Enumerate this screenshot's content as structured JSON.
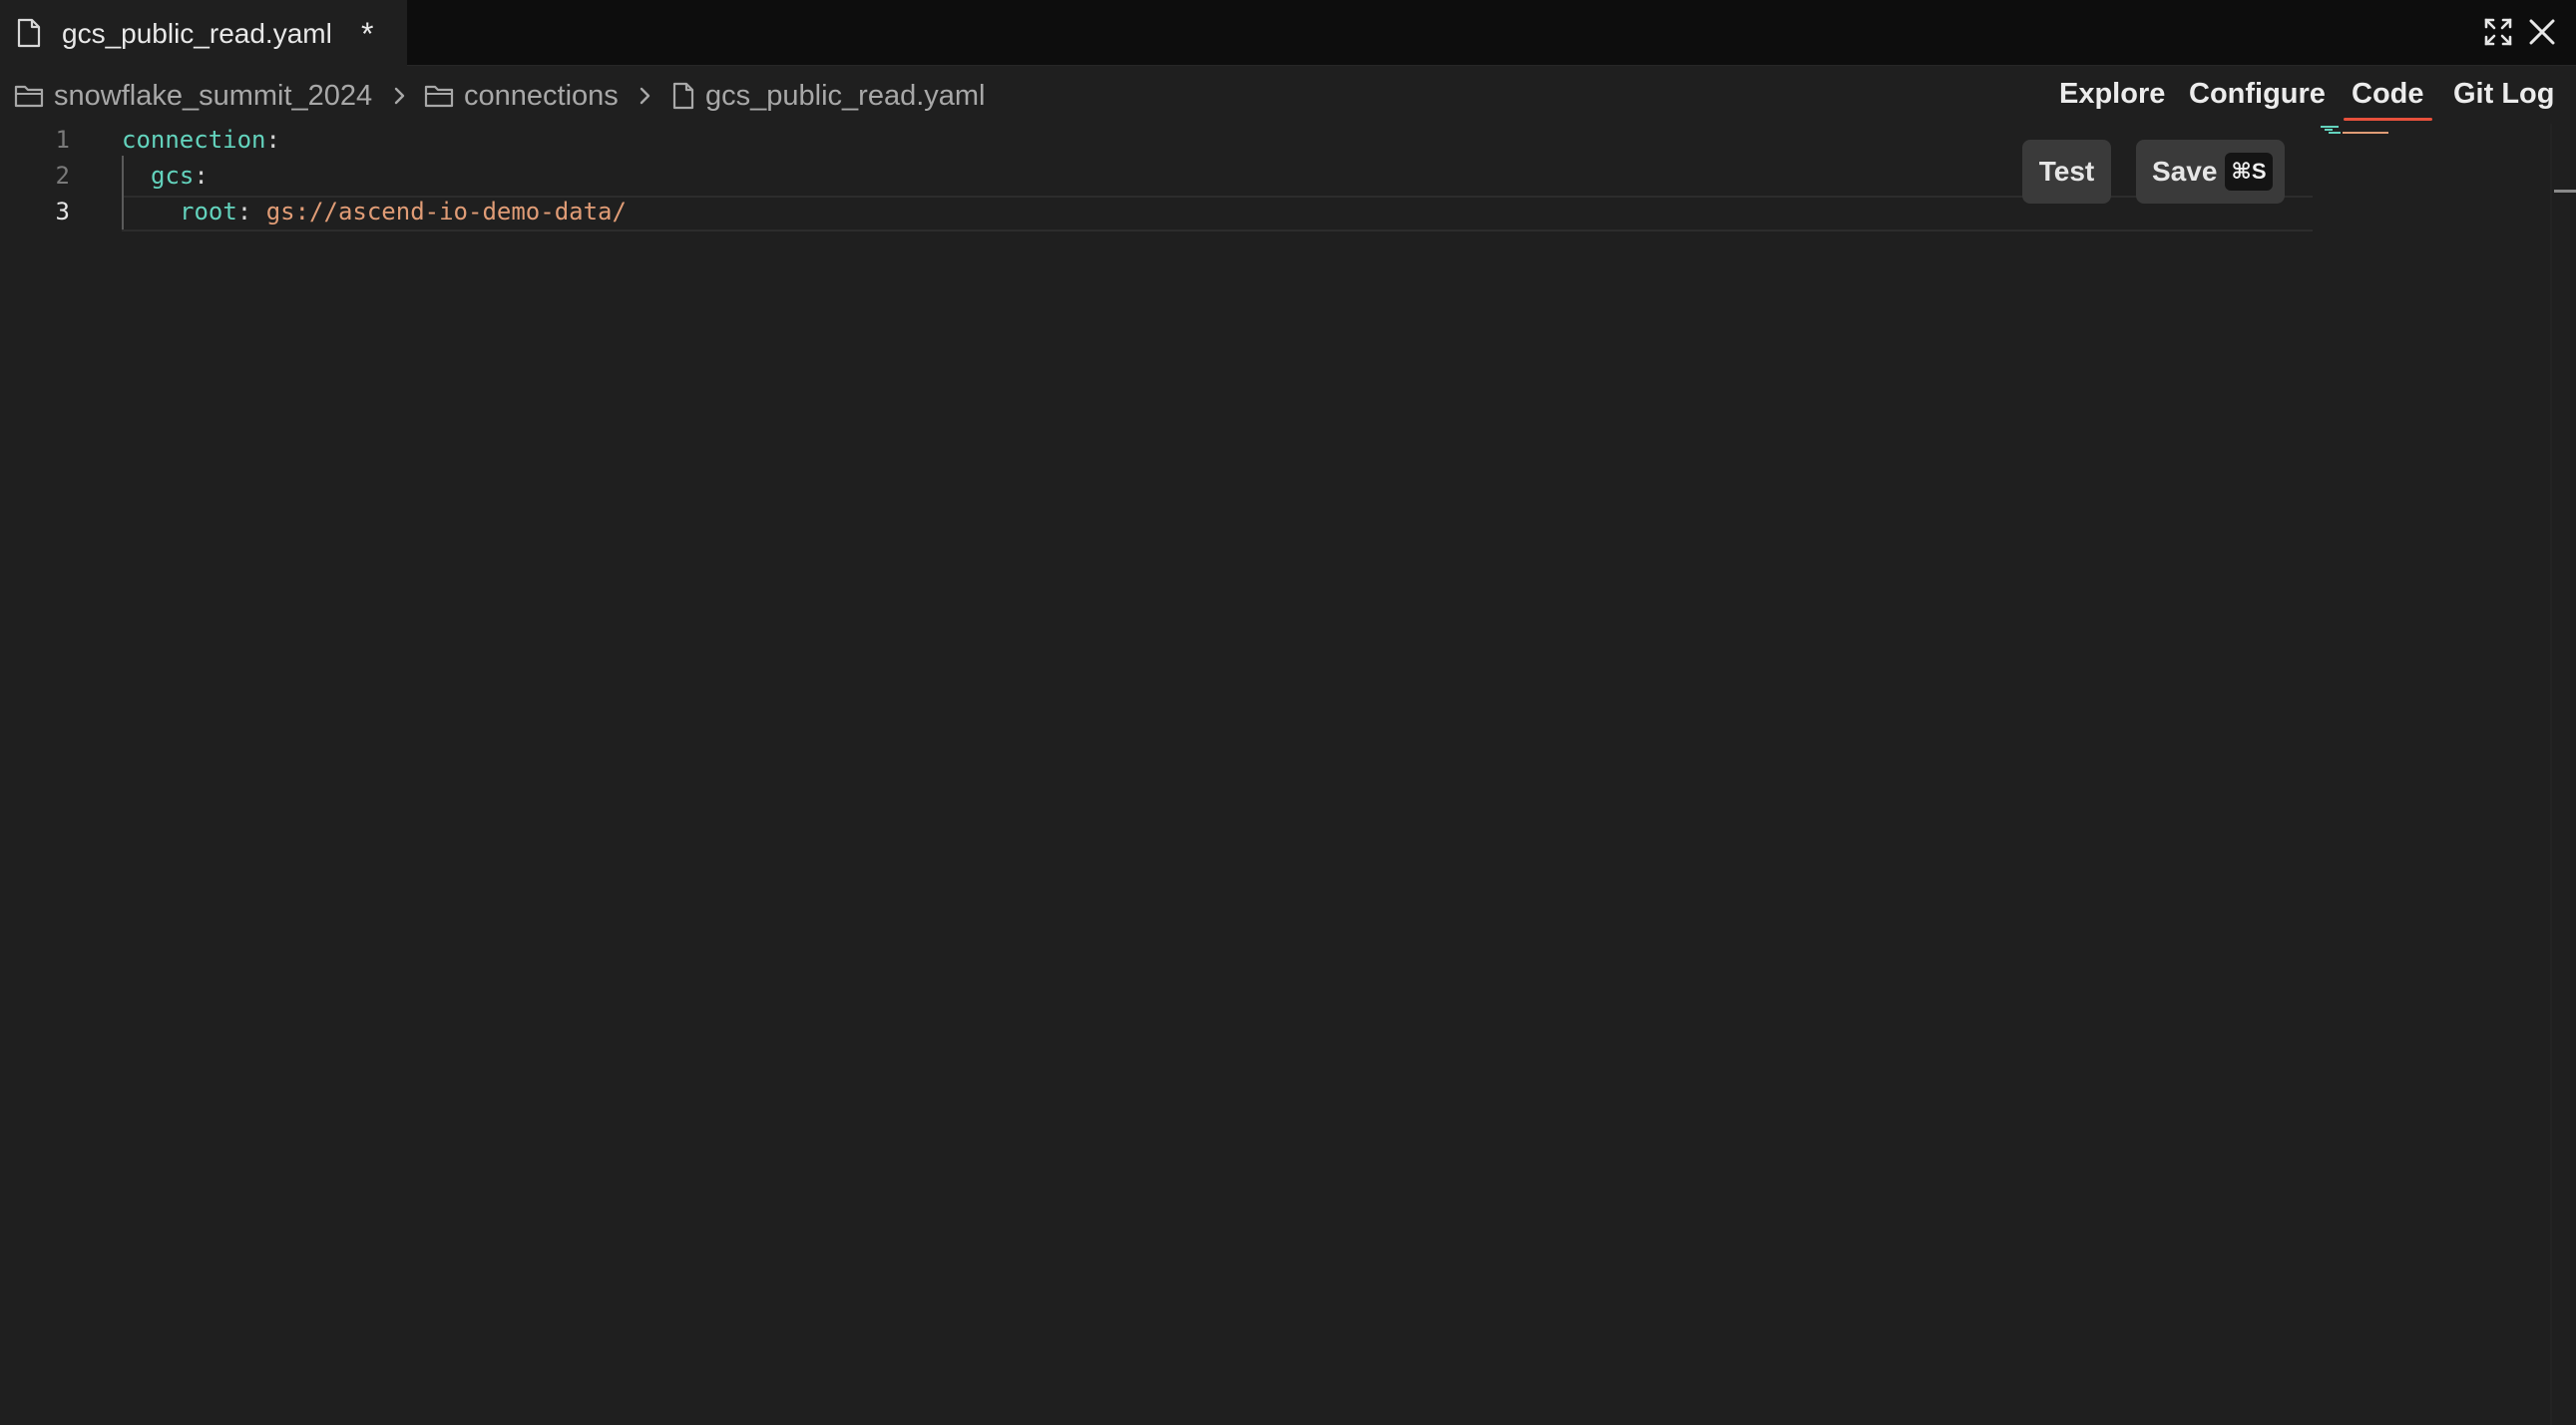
{
  "tab": {
    "title": "gcs_public_read.yaml",
    "dirty_marker": "*",
    "icon": "file-icon"
  },
  "window_controls": {
    "expand_icon": "expand-icon",
    "close_icon": "close-icon"
  },
  "breadcrumb": [
    {
      "label": "snowflake_summit_2024",
      "icon": "folder-icon"
    },
    {
      "label": "connections",
      "icon": "folder-icon"
    },
    {
      "label": "gcs_public_read.yaml",
      "icon": "file-icon"
    }
  ],
  "view_tabs": [
    {
      "label": "Explore",
      "active": false
    },
    {
      "label": "Configure",
      "active": false
    },
    {
      "label": "Code",
      "active": true
    },
    {
      "label": "Git Log",
      "active": false
    }
  ],
  "actions": {
    "test_label": "Test",
    "save_label": "Save",
    "save_shortcut": "⌘S"
  },
  "code": {
    "lines": [
      {
        "number": "1",
        "key": "connection",
        "colon": ":",
        "value": ""
      },
      {
        "number": "2",
        "key": "gcs",
        "colon": ":",
        "value": ""
      },
      {
        "number": "3",
        "key": "root",
        "colon": ":",
        "value": "gs://ascend-io-demo-data/"
      }
    ],
    "current_line": "3"
  },
  "colors": {
    "accent": "#e8513c",
    "yaml_key": "#63d3bd",
    "yaml_string": "#e09c76",
    "background": "#1f1f1f",
    "tabbar_background": "#0d0d0d"
  }
}
